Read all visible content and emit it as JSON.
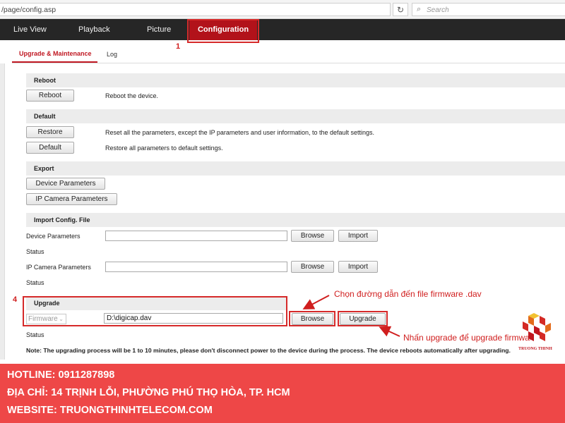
{
  "browser": {
    "url": "/page/config.asp",
    "refresh_icon": "refresh-icon",
    "search_placeholder": "Search"
  },
  "nav": {
    "items": [
      {
        "label": "Live View"
      },
      {
        "label": "Playback"
      },
      {
        "label": "Picture"
      },
      {
        "label": "Configuration"
      }
    ],
    "active": "Configuration",
    "active_color": "#b2121a"
  },
  "subtabs": {
    "active": "Upgrade & Maintenance",
    "other": "Log"
  },
  "sections": {
    "reboot": {
      "title": "Reboot",
      "button": "Reboot",
      "desc": "Reboot the device."
    },
    "default": {
      "title": "Default",
      "restore_button": "Restore",
      "restore_desc": "Reset all the parameters, except the IP parameters and user information, to the default settings.",
      "default_button": "Default",
      "default_desc": "Restore all parameters to default settings."
    },
    "export": {
      "title": "Export",
      "device_button": "Device Parameters",
      "ipcam_button": "IP Camera Parameters"
    },
    "import": {
      "title": "Import Config. File",
      "device_label": "Device Parameters",
      "device_value": "",
      "status_label_1": "Status",
      "ipcam_label": "IP Camera Parameters",
      "ipcam_value": "",
      "status_label_2": "Status",
      "browse": "Browse",
      "import": "Import"
    },
    "upgrade": {
      "title": "Upgrade",
      "select_value": "Firmware",
      "path_value": "D:\\digicap.dav",
      "browse": "Browse",
      "upgrade": "Upgrade",
      "status_label": "Status"
    }
  },
  "note": "Note: The upgrading process will be 1 to 10 minutes, please don't disconnect power to the device during the process. The device reboots automatically after upgrading.",
  "annotations": {
    "step_1": "1",
    "step_4": "4",
    "browse_hint": "Chọn đường dẫn đến file firmware .dav",
    "upgrade_hint": "Nhấn upgrade để upgrade firmware",
    "color": "#d01e1e"
  },
  "logo": {
    "text": "TRUONG THINH"
  },
  "footer": {
    "hotline": "HOTLINE: 0911287898",
    "address": "ĐỊA CHỈ: 14 TRỊNH LỖI, PHƯỜNG PHÚ THỌ HÒA, TP. HCM",
    "website": "WEBSITE: TRUONGTHINHTELECOM.COM",
    "background": "#ee4747"
  }
}
